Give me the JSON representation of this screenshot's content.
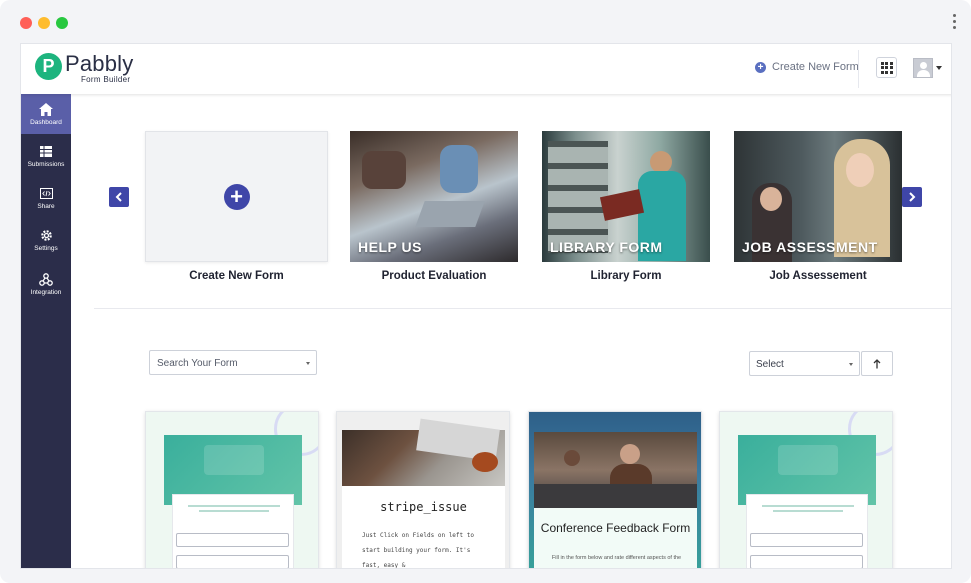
{
  "window": {
    "title": "Pabbly Form Builder"
  },
  "header": {
    "logo_mark": "P",
    "logo_name": "Pabbly",
    "logo_sub": "Form Builder",
    "create_link": "Create New Form"
  },
  "sidebar": {
    "items": [
      {
        "label": "Dashboard",
        "icon": "home-icon",
        "active": true
      },
      {
        "label": "Submissions",
        "icon": "table-icon",
        "active": false
      },
      {
        "label": "Share",
        "icon": "code-icon",
        "active": false
      },
      {
        "label": "Settings",
        "icon": "gear-icon",
        "active": false
      },
      {
        "label": "Integration",
        "icon": "webhook-icon",
        "active": false
      }
    ]
  },
  "templates": {
    "items": [
      {
        "name": "Create New Form",
        "caption": ""
      },
      {
        "name": "Product Evaluation",
        "caption": "HELP US"
      },
      {
        "name": "Library Form",
        "caption": "LIBRARY FORM"
      },
      {
        "name": "Job Assessement",
        "caption": "JOB ASSESSMENT"
      }
    ]
  },
  "filters": {
    "search_placeholder": "Search Your Form",
    "sort_select": "Select"
  },
  "forms": [
    {
      "title": "",
      "description": ""
    },
    {
      "title": "stripe_issue",
      "description": "Just Click on Fields on left to start building your form. It's fast, easy &"
    },
    {
      "title": "Conference Feedback Form",
      "description": "Fill in the form below and rate different aspects of the"
    },
    {
      "title": "",
      "description": ""
    }
  ],
  "colors": {
    "sidebar_bg": "#2b2d4a",
    "sidebar_active": "#5a5fa8",
    "accent": "#3f46a8",
    "brand_green": "#1db47e"
  }
}
